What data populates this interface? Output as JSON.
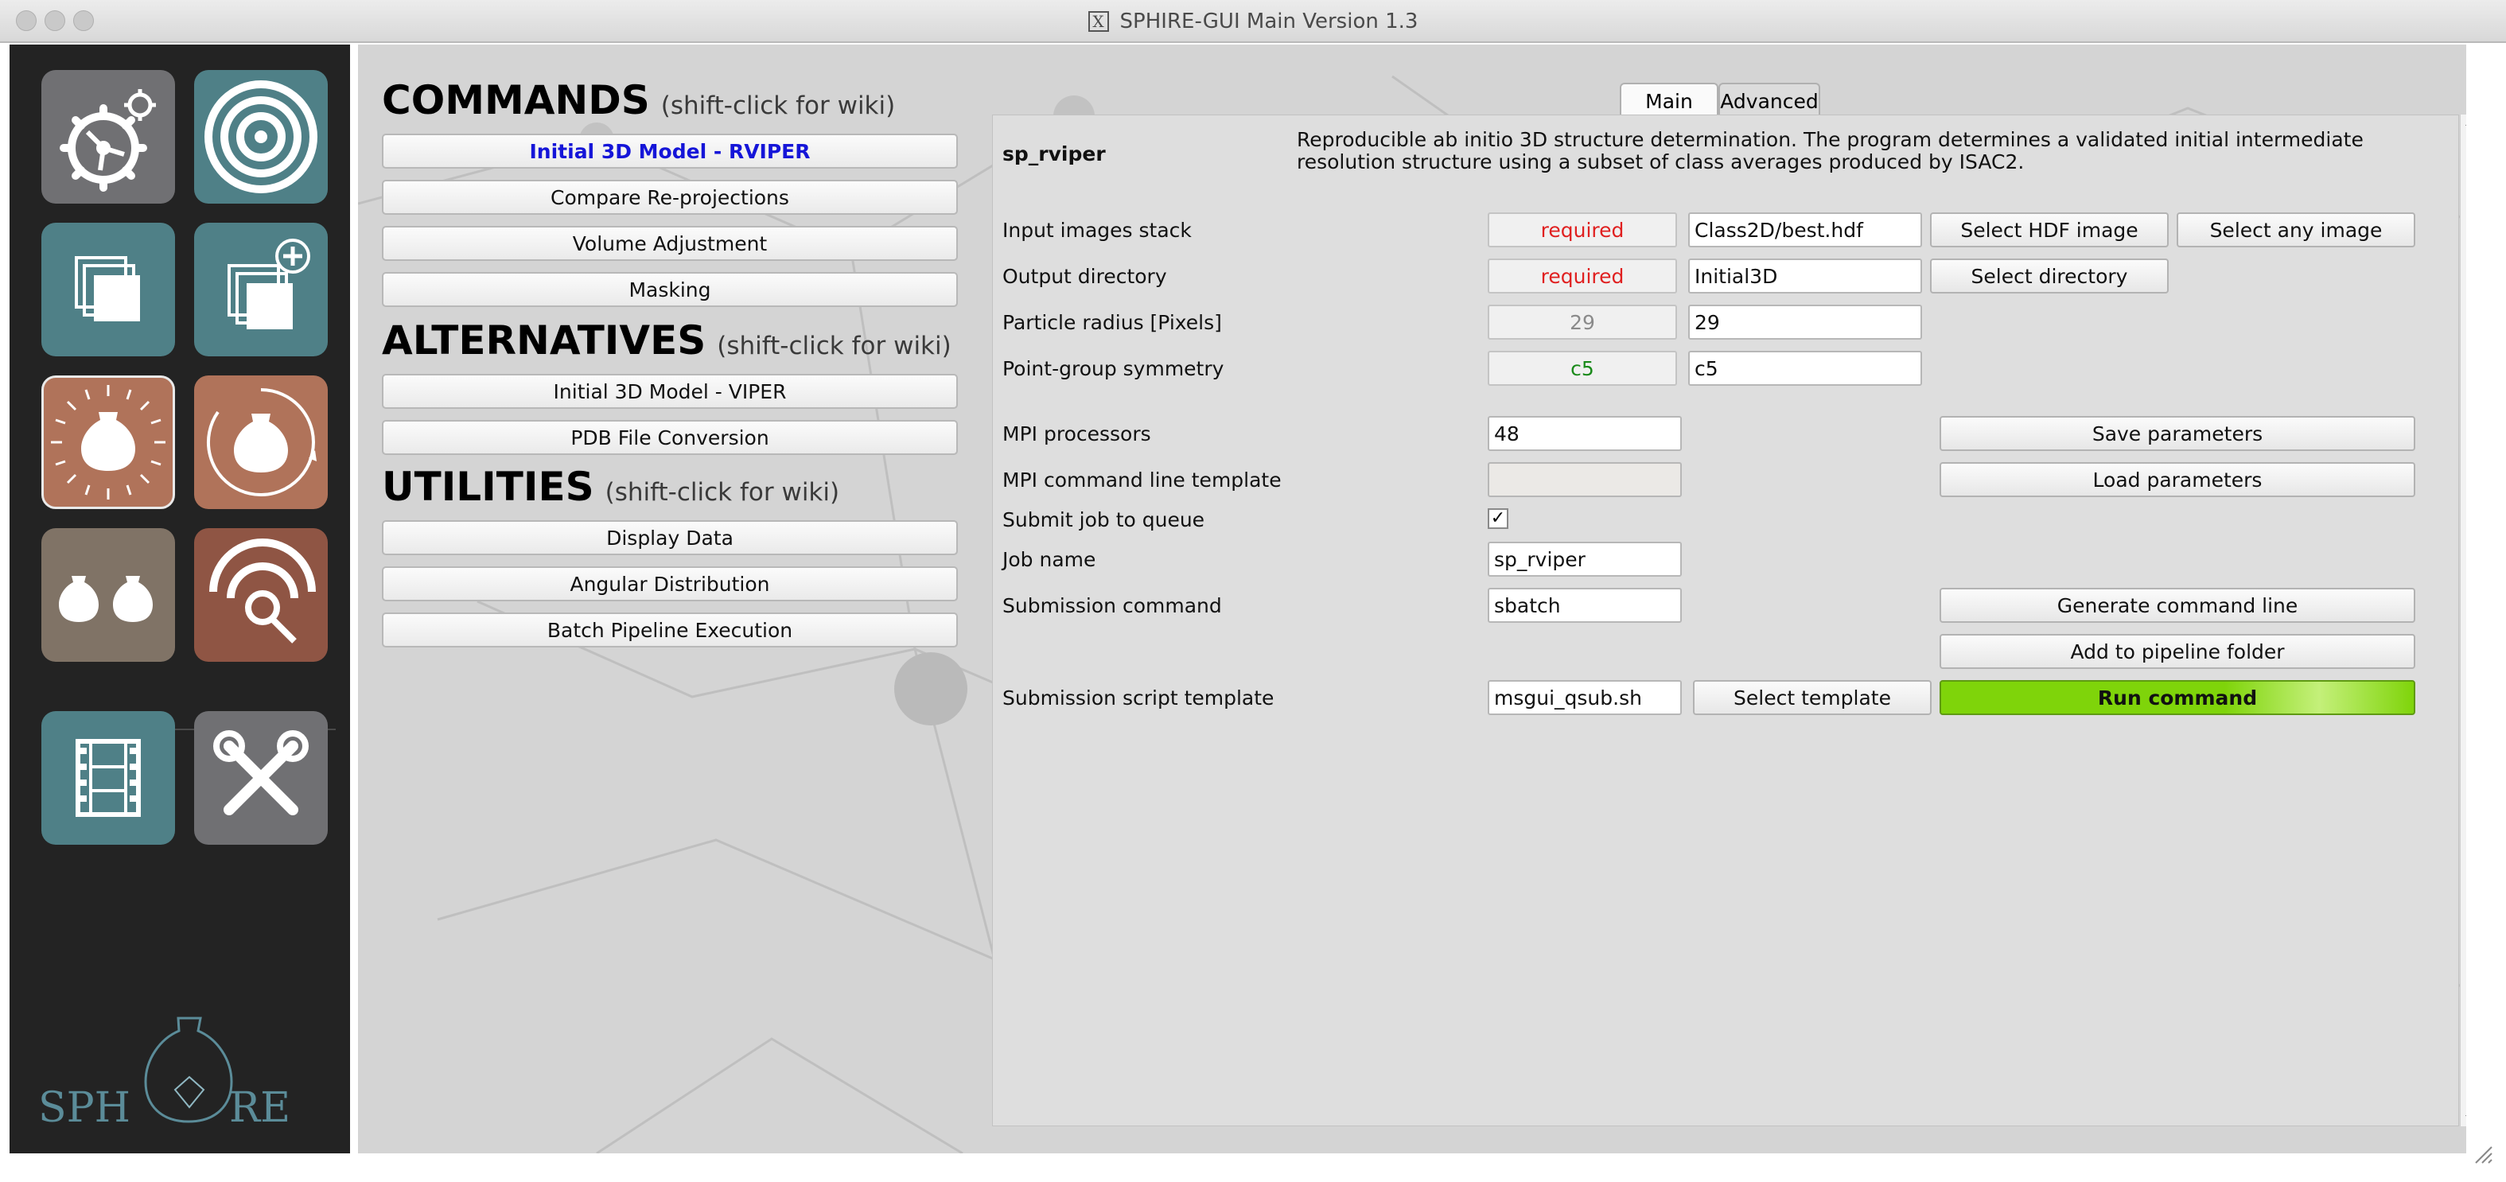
{
  "window": {
    "title": "SPHIRE-GUI Main Version 1.3"
  },
  "sidebar": {
    "logo_text": "SPHIRE",
    "tiles": [
      {
        "icon": "settings-gears-icon"
      },
      {
        "icon": "target-rings-icon"
      },
      {
        "icon": "image-stack-icon"
      },
      {
        "icon": "image-stack-add-icon"
      },
      {
        "icon": "initial-model-icon"
      },
      {
        "icon": "refinement-icon"
      },
      {
        "icon": "heterogeneity-icon"
      },
      {
        "icon": "localres-icon"
      },
      {
        "icon": "movie-film-icon"
      },
      {
        "icon": "utilities-tools-icon"
      }
    ]
  },
  "sections": {
    "commands": {
      "title": "COMMANDS",
      "hint": "(shift-click for wiki)",
      "items": [
        "Initial 3D Model - RVIPER",
        "Compare Re-projections",
        "Volume Adjustment",
        "Masking"
      ]
    },
    "alternatives": {
      "title": "ALTERNATIVES",
      "hint": "(shift-click for wiki)",
      "items": [
        "Initial 3D Model - VIPER",
        "PDB File Conversion"
      ]
    },
    "utilities": {
      "title": "UTILITIES",
      "hint": "(shift-click for wiki)",
      "items": [
        "Display Data",
        "Angular Distribution",
        "Batch Pipeline Execution"
      ]
    }
  },
  "tabs": {
    "main": "Main",
    "advanced": "Advanced"
  },
  "program": {
    "name": "sp_rviper",
    "description_line1": "Reproducible ab initio 3D structure determination. The program determines a validated initial intermediate",
    "description_line2": "resolution structure using a subset of class averages produced by ISAC2."
  },
  "params": {
    "input_stack": {
      "label": "Input images stack",
      "default": "required",
      "value": "Class2D/best.hdf",
      "btn1": "Select HDF image",
      "btn2": "Select any image"
    },
    "output_dir": {
      "label": "Output directory",
      "default": "required",
      "value": "Initial3D",
      "btn1": "Select directory"
    },
    "radius": {
      "label": "Particle radius [Pixels]",
      "default": "29",
      "value": "29"
    },
    "symmetry": {
      "label": "Point-group symmetry",
      "default": "c5",
      "value": "c5"
    }
  },
  "mpi": {
    "processors_label": "MPI processors",
    "processors_value": "48",
    "template_label": "MPI command line template",
    "template_value": "",
    "queue_label": "Submit job to queue",
    "queue_checked": "✓",
    "job_label": "Job name",
    "job_value": "sp_rviper",
    "submit_label": "Submission command",
    "submit_value": "sbatch",
    "script_label": "Submission script template",
    "script_value": "msgui_qsub.sh",
    "select_template": "Select template"
  },
  "actions": {
    "save": "Save parameters",
    "load": "Load parameters",
    "generate": "Generate command line",
    "pipeline": "Add to pipeline folder",
    "run": "Run command"
  },
  "colors": {
    "required": "#e02020",
    "default_green": "#1a8a1a",
    "active_command": "#1515d8",
    "run_button": "#7fd40a"
  }
}
